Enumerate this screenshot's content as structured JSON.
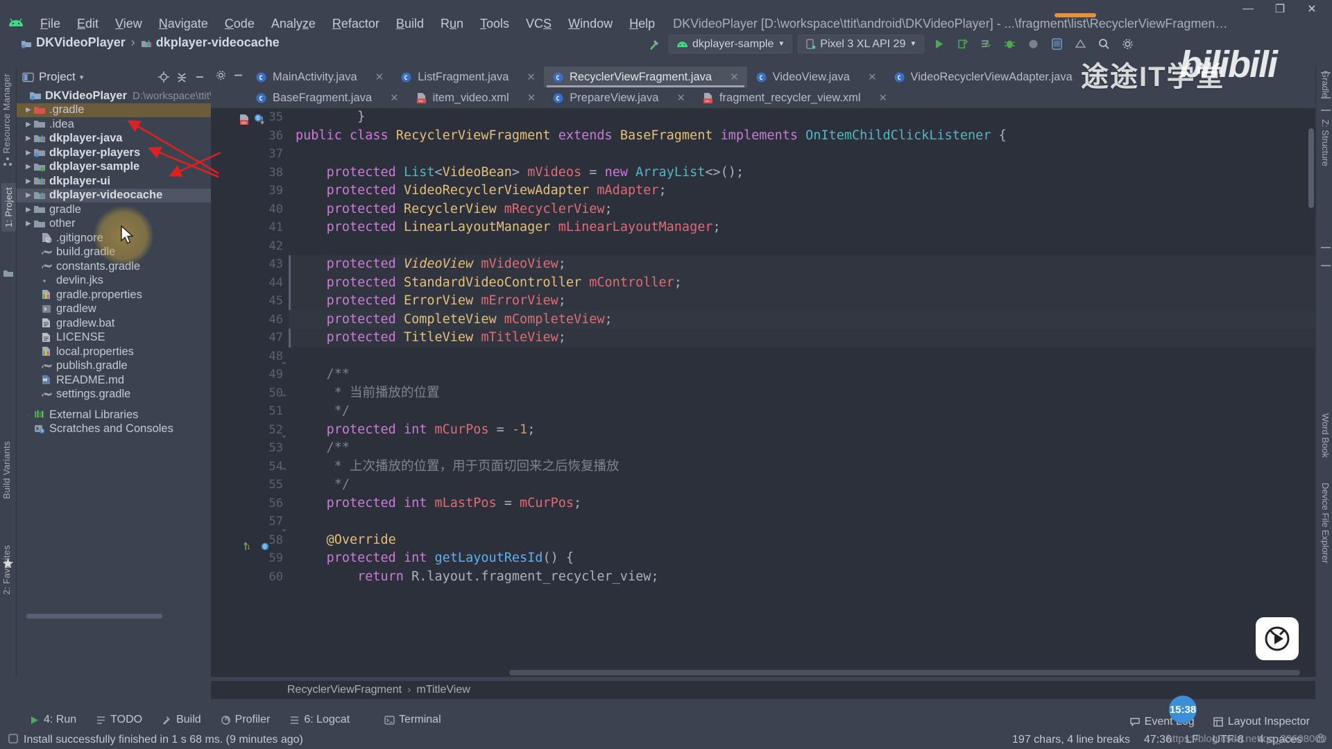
{
  "window": {
    "title": "DKVideoPlayer [D:\\workspace\\ttit\\android\\DKVideoPlayer] - ...\\fragment\\list\\RecyclerViewFragment.java [dkplayer-sample]",
    "minimize": "—",
    "maximize": "❐",
    "close": "✕"
  },
  "menu": {
    "items": [
      "File",
      "Edit",
      "View",
      "Navigate",
      "Code",
      "Analyze",
      "Refactor",
      "Build",
      "Run",
      "Tools",
      "VCS",
      "Window",
      "Help"
    ]
  },
  "breadcrumb_top": {
    "project": "DKVideoPlayer",
    "module": "dkplayer-videocache",
    "separator": "›"
  },
  "toolbar": {
    "run_config": "dkplayer-sample",
    "device": "Pixel 3 XL API 29",
    "dropdown_caret": "▼"
  },
  "left_strip": {
    "tabs": [
      "Resource Manager",
      "1: Project",
      "Build Variants",
      "2: Favorites"
    ]
  },
  "right_strip": {
    "tabs": [
      "Gradle",
      "Z: Structure",
      "Word Book",
      "Device File Explorer"
    ]
  },
  "project_panel": {
    "header_title": "Project",
    "header_caret": "▾",
    "root": {
      "label": "DKVideoPlayer",
      "path": "D:\\workspace\\ttit\\andro"
    },
    "items": [
      {
        "label": ".gradle",
        "icon": "folder-red-icon",
        "expandable": true,
        "bold": false,
        "state": "hover"
      },
      {
        "label": ".idea",
        "icon": "folder-icon",
        "expandable": true,
        "bold": false,
        "state": ""
      },
      {
        "label": "dkplayer-java",
        "icon": "module-icon",
        "expandable": true,
        "bold": true,
        "state": ""
      },
      {
        "label": "dkplayer-players",
        "icon": "folder-blue-icon",
        "expandable": true,
        "bold": true,
        "state": ""
      },
      {
        "label": "dkplayer-sample",
        "icon": "module-green-icon",
        "expandable": true,
        "bold": true,
        "state": ""
      },
      {
        "label": "dkplayer-ui",
        "icon": "module-icon",
        "expandable": true,
        "bold": true,
        "state": ""
      },
      {
        "label": "dkplayer-videocache",
        "icon": "module-icon",
        "expandable": true,
        "bold": true,
        "state": "selected"
      },
      {
        "label": "gradle",
        "icon": "folder-icon",
        "expandable": true,
        "bold": false,
        "state": ""
      },
      {
        "label": "other",
        "icon": "folder-icon",
        "expandable": true,
        "bold": false,
        "state": ""
      },
      {
        "label": ".gitignore",
        "icon": "gitignore-icon",
        "expandable": false,
        "bold": false,
        "state": ""
      },
      {
        "label": "build.gradle",
        "icon": "gradle-icon",
        "expandable": false,
        "bold": false,
        "state": ""
      },
      {
        "label": "constants.gradle",
        "icon": "gradle-icon",
        "expandable": false,
        "bold": false,
        "state": ""
      },
      {
        "label": "devlin.jks",
        "icon": "file-dot-icon",
        "expandable": false,
        "bold": false,
        "state": ""
      },
      {
        "label": "gradle.properties",
        "icon": "properties-icon",
        "expandable": false,
        "bold": false,
        "state": ""
      },
      {
        "label": "gradlew",
        "icon": "script-icon",
        "expandable": false,
        "bold": false,
        "state": ""
      },
      {
        "label": "gradlew.bat",
        "icon": "text-file-icon",
        "expandable": false,
        "bold": false,
        "state": ""
      },
      {
        "label": "LICENSE",
        "icon": "text-file-icon",
        "expandable": false,
        "bold": false,
        "state": ""
      },
      {
        "label": "local.properties",
        "icon": "properties-icon",
        "expandable": false,
        "bold": false,
        "state": ""
      },
      {
        "label": "publish.gradle",
        "icon": "gradle-icon",
        "expandable": false,
        "bold": false,
        "state": ""
      },
      {
        "label": "README.md",
        "icon": "markdown-icon",
        "expandable": false,
        "bold": false,
        "state": ""
      },
      {
        "label": "settings.gradle",
        "icon": "gradle-icon",
        "expandable": false,
        "bold": false,
        "state": ""
      }
    ],
    "extra": [
      {
        "label": "External Libraries",
        "icon": "libraries-icon"
      },
      {
        "label": "Scratches and Consoles",
        "icon": "scratches-icon"
      }
    ]
  },
  "editor_tabs": {
    "row1": [
      {
        "label": "MainActivity.java",
        "icon": "java-class-icon",
        "active": false
      },
      {
        "label": "ListFragment.java",
        "icon": "java-class-icon",
        "active": false
      },
      {
        "label": "RecyclerViewFragment.java",
        "icon": "java-class-icon",
        "active": true
      },
      {
        "label": "VideoView.java",
        "icon": "java-class-icon",
        "active": false
      },
      {
        "label": "VideoRecyclerViewAdapter.java",
        "icon": "java-class-icon",
        "active": false
      }
    ],
    "row2": [
      {
        "label": "BaseFragment.java",
        "icon": "java-class-icon",
        "active": false
      },
      {
        "label": "item_video.xml",
        "icon": "xml-file-icon",
        "active": false
      },
      {
        "label": "PrepareView.java",
        "icon": "java-class-icon",
        "active": false
      },
      {
        "label": "fragment_recycler_view.xml",
        "icon": "xml-file-icon",
        "active": false
      }
    ],
    "close_glyph": "✕"
  },
  "code": {
    "first_line_number": 35,
    "lines": [
      {
        "n": 35,
        "tokens": [
          {
            "t": "        }",
            "c": "plain"
          }
        ]
      },
      {
        "n": 36,
        "tokens": [
          {
            "t": "public ",
            "c": "kw"
          },
          {
            "t": "class ",
            "c": "kw"
          },
          {
            "t": "RecyclerViewFragment ",
            "c": "type"
          },
          {
            "t": "extends ",
            "c": "kw"
          },
          {
            "t": "BaseFragment ",
            "c": "type"
          },
          {
            "t": "implements ",
            "c": "kw"
          },
          {
            "t": "OnItemChildClickListener ",
            "c": "type2"
          },
          {
            "t": "{",
            "c": "plain"
          }
        ]
      },
      {
        "n": 37,
        "tokens": [
          {
            "t": "",
            "c": "plain"
          }
        ]
      },
      {
        "n": 38,
        "tokens": [
          {
            "t": "    ",
            "c": "plain"
          },
          {
            "t": "protected ",
            "c": "kw"
          },
          {
            "t": "List",
            "c": "type2"
          },
          {
            "t": "<",
            "c": "plain"
          },
          {
            "t": "VideoBean",
            "c": "type"
          },
          {
            "t": "> ",
            "c": "plain"
          },
          {
            "t": "mVideos",
            "c": "ident"
          },
          {
            "t": " = ",
            "c": "plain"
          },
          {
            "t": "new ",
            "c": "kw"
          },
          {
            "t": "ArrayList",
            "c": "type2"
          },
          {
            "t": "<>();",
            "c": "plain"
          }
        ]
      },
      {
        "n": 39,
        "tokens": [
          {
            "t": "    ",
            "c": "plain"
          },
          {
            "t": "protected ",
            "c": "kw"
          },
          {
            "t": "VideoRecyclerViewAdapter ",
            "c": "type"
          },
          {
            "t": "mAdapter",
            "c": "ident"
          },
          {
            "t": ";",
            "c": "plain"
          }
        ]
      },
      {
        "n": 40,
        "tokens": [
          {
            "t": "    ",
            "c": "plain"
          },
          {
            "t": "protected ",
            "c": "kw"
          },
          {
            "t": "RecyclerView ",
            "c": "type"
          },
          {
            "t": "mRecyclerView",
            "c": "ident"
          },
          {
            "t": ";",
            "c": "plain"
          }
        ]
      },
      {
        "n": 41,
        "tokens": [
          {
            "t": "    ",
            "c": "plain"
          },
          {
            "t": "protected ",
            "c": "kw"
          },
          {
            "t": "LinearLayoutManager ",
            "c": "type"
          },
          {
            "t": "mLinearLayoutManager",
            "c": "ident"
          },
          {
            "t": ";",
            "c": "plain"
          }
        ]
      },
      {
        "n": 42,
        "tokens": [
          {
            "t": "",
            "c": "plain"
          }
        ]
      },
      {
        "n": 43,
        "tokens": [
          {
            "t": "    ",
            "c": "plain"
          },
          {
            "t": "protected ",
            "c": "kw"
          },
          {
            "t": "VideoView ",
            "c": "type italic"
          },
          {
            "t": "mVideoView",
            "c": "ident"
          },
          {
            "t": ";",
            "c": "plain"
          }
        ]
      },
      {
        "n": 44,
        "tokens": [
          {
            "t": "    ",
            "c": "plain"
          },
          {
            "t": "protected ",
            "c": "kw"
          },
          {
            "t": "StandardVideoController ",
            "c": "type"
          },
          {
            "t": "mController",
            "c": "ident"
          },
          {
            "t": ";",
            "c": "plain"
          }
        ]
      },
      {
        "n": 45,
        "tokens": [
          {
            "t": "    ",
            "c": "plain"
          },
          {
            "t": "protected ",
            "c": "kw"
          },
          {
            "t": "ErrorView ",
            "c": "type"
          },
          {
            "t": "mErrorView",
            "c": "ident"
          },
          {
            "t": ";",
            "c": "plain"
          }
        ]
      },
      {
        "n": 46,
        "tokens": [
          {
            "t": "    ",
            "c": "plain"
          },
          {
            "t": "protected ",
            "c": "kw"
          },
          {
            "t": "CompleteView ",
            "c": "type"
          },
          {
            "t": "mCompleteView",
            "c": "ident"
          },
          {
            "t": ";",
            "c": "plain"
          }
        ]
      },
      {
        "n": 47,
        "tokens": [
          {
            "t": "    ",
            "c": "plain"
          },
          {
            "t": "protected ",
            "c": "kw"
          },
          {
            "t": "TitleView ",
            "c": "type"
          },
          {
            "t": "mTitleView",
            "c": "ident"
          },
          {
            "t": ";",
            "c": "plain"
          }
        ]
      },
      {
        "n": 48,
        "tokens": [
          {
            "t": "",
            "c": "plain"
          }
        ]
      },
      {
        "n": 49,
        "tokens": [
          {
            "t": "    /**",
            "c": "cmt"
          }
        ]
      },
      {
        "n": 50,
        "tokens": [
          {
            "t": "     * 当前播放的位置",
            "c": "cmt"
          }
        ]
      },
      {
        "n": 51,
        "tokens": [
          {
            "t": "     */",
            "c": "cmt"
          }
        ]
      },
      {
        "n": 52,
        "tokens": [
          {
            "t": "    ",
            "c": "plain"
          },
          {
            "t": "protected ",
            "c": "kw"
          },
          {
            "t": "int ",
            "c": "kw"
          },
          {
            "t": "mCurPos",
            "c": "ident"
          },
          {
            "t": " = ",
            "c": "plain"
          },
          {
            "t": "-1",
            "c": "num"
          },
          {
            "t": ";",
            "c": "plain"
          }
        ]
      },
      {
        "n": 53,
        "tokens": [
          {
            "t": "    /**",
            "c": "cmt"
          }
        ]
      },
      {
        "n": 54,
        "tokens": [
          {
            "t": "     * 上次播放的位置，用于页面切回来之后恢复播放",
            "c": "cmt"
          }
        ]
      },
      {
        "n": 55,
        "tokens": [
          {
            "t": "     */",
            "c": "cmt"
          }
        ]
      },
      {
        "n": 56,
        "tokens": [
          {
            "t": "    ",
            "c": "plain"
          },
          {
            "t": "protected ",
            "c": "kw"
          },
          {
            "t": "int ",
            "c": "kw"
          },
          {
            "t": "mLastPos",
            "c": "ident"
          },
          {
            "t": " = ",
            "c": "plain"
          },
          {
            "t": "mCurPos",
            "c": "ident"
          },
          {
            "t": ";",
            "c": "plain"
          }
        ]
      },
      {
        "n": 57,
        "tokens": [
          {
            "t": "",
            "c": "plain"
          }
        ]
      },
      {
        "n": 58,
        "tokens": [
          {
            "t": "    @Override",
            "c": "annot"
          }
        ]
      },
      {
        "n": 59,
        "tokens": [
          {
            "t": "    ",
            "c": "plain"
          },
          {
            "t": "protected ",
            "c": "kw"
          },
          {
            "t": "int ",
            "c": "kw"
          },
          {
            "t": "getLayoutResId",
            "c": "meth"
          },
          {
            "t": "() {",
            "c": "plain"
          }
        ]
      },
      {
        "n": 60,
        "tokens": [
          {
            "t": "        ",
            "c": "plain"
          },
          {
            "t": "return ",
            "c": "kw"
          },
          {
            "t": "R.layout.fragment_recycler_view",
            "c": "plain"
          },
          {
            "t": ";",
            "c": "plain"
          }
        ]
      }
    ]
  },
  "editor_breadcrumb": {
    "class": "RecyclerViewFragment",
    "member": "mTitleView",
    "separator": "›"
  },
  "bottom_toolbar": {
    "items": [
      {
        "label": "4: Run",
        "icon": "run-icon"
      },
      {
        "label": "TODO",
        "icon": "todo-icon"
      },
      {
        "label": "Build",
        "icon": "build-icon"
      },
      {
        "label": "Profiler",
        "icon": "profiler-icon"
      },
      {
        "label": "6: Logcat",
        "icon": "logcat-icon"
      },
      {
        "label": "Terminal",
        "icon": "terminal-icon"
      }
    ]
  },
  "statusbar": {
    "message": "Install successfully finished in 1 s 68 ms. (9 minutes ago)",
    "chars": "197 chars, 4 line breaks",
    "caret": "47:36",
    "line_sep": "LF",
    "encoding": "UTF-8",
    "indent": "4 spaces",
    "event_log": "Event Log",
    "layout_inspector": "Layout Inspector"
  },
  "overlays": {
    "watermark_cn": "途途IT学堂",
    "watermark_bili": "bilibili",
    "csdn_url": "https://blog.csdn.net/qq_33608000",
    "rec_time": "15:38"
  },
  "colors": {
    "bg_chrome": "#3c4350",
    "bg_editor": "#2b303b",
    "selection": "#4e5565",
    "accent_orange": "#e8913a",
    "accent_blue": "#3a8fd8",
    "red_arrow": "#e02020",
    "cursor_glow": "#c7a03c"
  }
}
